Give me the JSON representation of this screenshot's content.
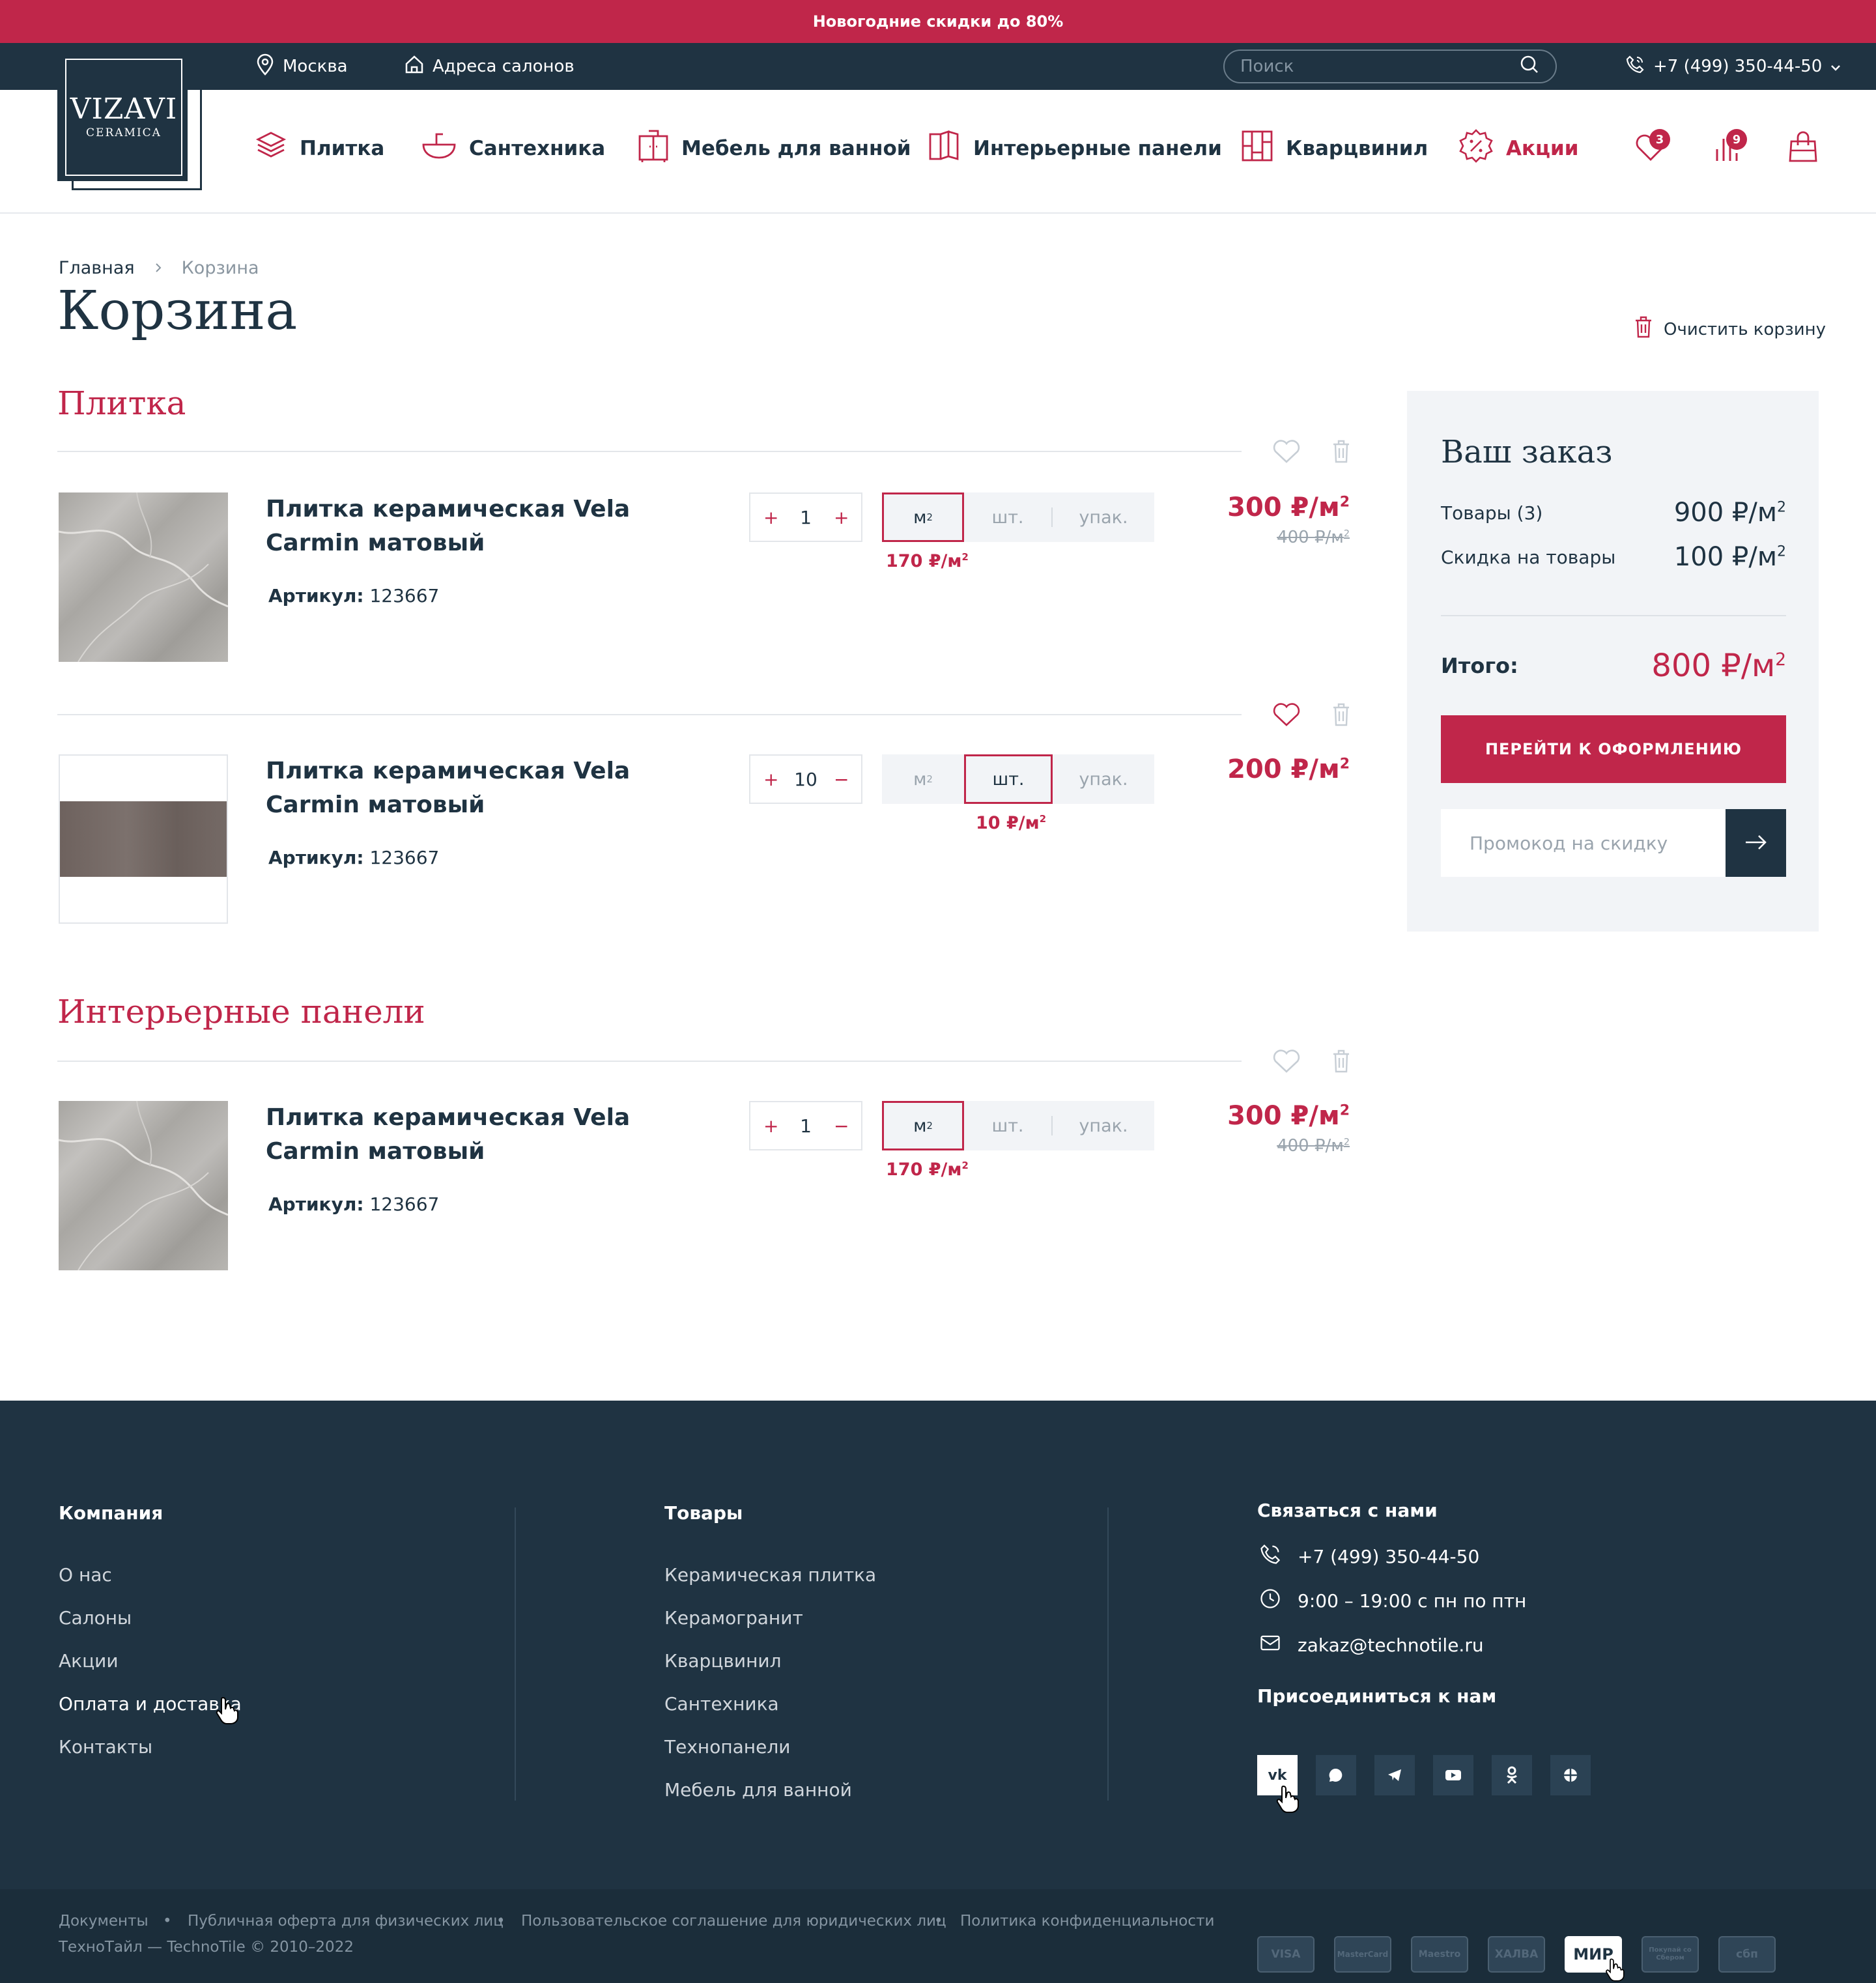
{
  "promo_bar": {
    "text": "Новогодние скидки до 80%"
  },
  "topbar": {
    "city": "Москва",
    "salons": "Адреса салонов",
    "search_placeholder": "Поиск",
    "phone": "+7 (499) 350-44-50"
  },
  "logo": {
    "word": "VIZAVI",
    "sub": "CERAMICA"
  },
  "nav": {
    "items": [
      {
        "label": "Плитка",
        "icon": "tile-layers-icon"
      },
      {
        "label": "Сантехника",
        "icon": "sink-icon"
      },
      {
        "label": "Мебель для ванной",
        "icon": "cabinet-icon"
      },
      {
        "label": "Интерьерные панели",
        "icon": "panels-icon"
      },
      {
        "label": "Кварцвинил",
        "icon": "vinyl-icon"
      },
      {
        "label": "Акции",
        "icon": "percent-badge-icon"
      }
    ],
    "favorites_count": "3",
    "compare_count": "9"
  },
  "breadcrumb": {
    "home": "Главная",
    "current": "Корзина"
  },
  "page": {
    "title": "Корзина",
    "clear_cart": "Очистить корзину"
  },
  "sections": [
    {
      "title": "Плитка",
      "items": [
        {
          "name": "Плитка керамическая Vela Carmin матовый",
          "sku_label": "Артикул:",
          "sku": "123667",
          "minus": "+",
          "qty": "1",
          "plus": "+",
          "units": [
            "м",
            "шт.",
            "упак."
          ],
          "selected_unit": 0,
          "unit_price": "170 ₽/м",
          "price": "300 ₽/м",
          "old_price": "400 ₽/м"
        },
        {
          "name": "Плитка керамическая Vela Carmin матовый",
          "sku_label": "Артикул:",
          "sku": "123667",
          "minus": "+",
          "qty": "10",
          "plus": "−",
          "units": [
            "м",
            "шт.",
            "упак."
          ],
          "selected_unit": 1,
          "unit_price": "10 ₽/м",
          "price": "200 ₽/м",
          "old_price": ""
        }
      ]
    },
    {
      "title": "Интерьерные панели",
      "items": [
        {
          "name": "Плитка керамическая Vela Carmin матовый",
          "sku_label": "Артикул:",
          "sku": "123667",
          "minus": "+",
          "qty": "1",
          "plus": "−",
          "units": [
            "м",
            "шт.",
            "упак."
          ],
          "selected_unit": 0,
          "unit_price": "170 ₽/м",
          "price": "300 ₽/м",
          "old_price": "400 ₽/м"
        }
      ]
    }
  ],
  "summary": {
    "title": "Ваш заказ",
    "goods_label": "Товары (3)",
    "goods_value": "900 ₽/м",
    "discount_label": "Скидка на товары",
    "discount_value": "100 ₽/м",
    "total_label": "Итого:",
    "total_value": "800 ₽/м",
    "checkout": "ПЕРЕЙТИ К ОФОРМЛЕНИЮ",
    "promo_placeholder": "Промокод на скидку"
  },
  "footer": {
    "company": {
      "title": "Компания",
      "links": [
        "О нас",
        "Салоны",
        "Акции",
        "Оплата и доставка",
        "Контакты"
      ]
    },
    "goods": {
      "title": "Товары",
      "links": [
        "Керамическая плитка",
        "Керамогранит",
        "Кварцвинил",
        "Сантехника",
        "Технопанели",
        "Мебель для ванной"
      ]
    },
    "contact": {
      "title": "Связаться с нами",
      "phone": "+7 (499) 350-44-50",
      "hours": "9:00 – 19:00  с пн по птн",
      "email": "zakaz@technotile.ru",
      "join": "Присоединиться к нам",
      "socials": [
        "vk-icon",
        "whatsapp-icon",
        "telegram-icon",
        "youtube-icon",
        "odnoklassniki-icon",
        "globe-icon"
      ]
    },
    "bottom_links": [
      "Документы",
      "Публичная оферта для физических лиц",
      "Пользовательское соглашение для юридических лиц",
      "Политика конфиденциальности"
    ],
    "copyright": "ТехноТайл — TechnoTile © 2010–2022",
    "payments": [
      "VISA",
      "MasterCard",
      "Maestro",
      "ХАЛВА",
      "МИР",
      "Покупай со Сбером",
      "сбп"
    ]
  },
  "colors": {
    "accent": "#c0264a",
    "dark": "#1f3342",
    "panel": "#f2f4f7"
  }
}
